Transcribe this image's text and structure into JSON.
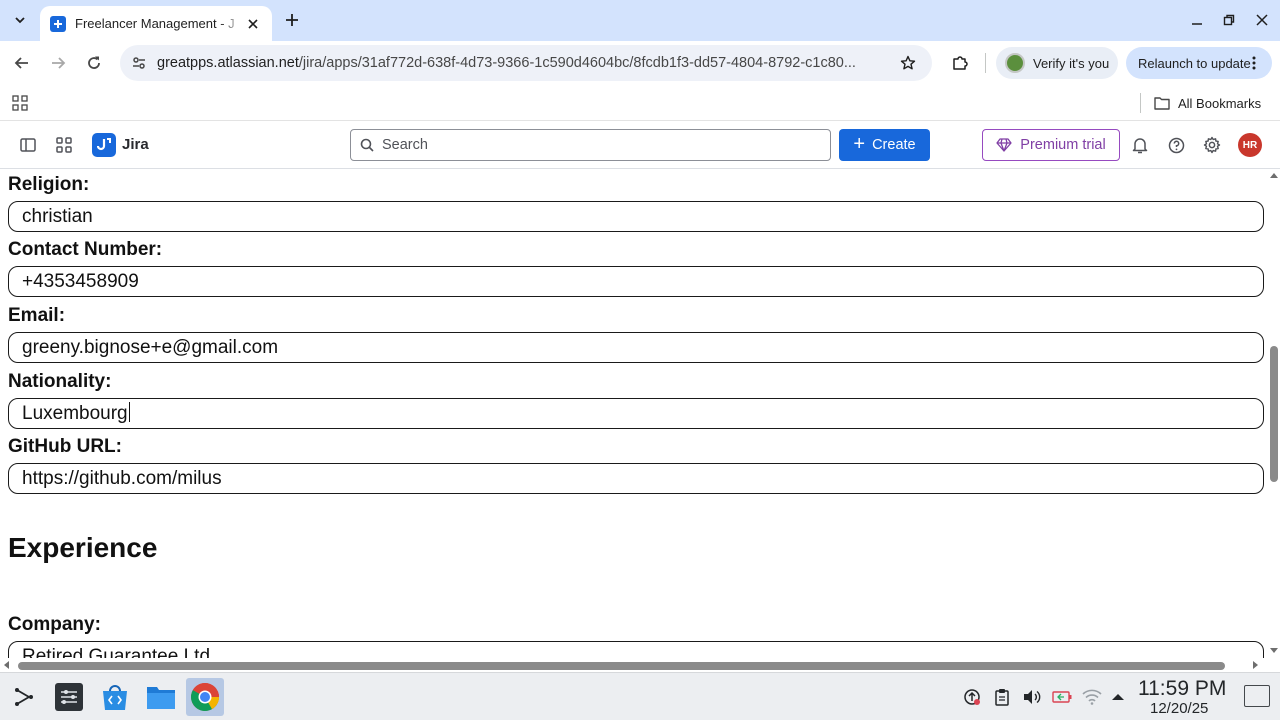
{
  "browser": {
    "tab_title": "Freelancer Management - J",
    "url_host": "greatpps.atlassian.net",
    "url_path": "/jira/apps/31af772d-638f-4d73-9366-1c590d4604bc/8fcdb1f3-dd57-4804-8792-c1c80...",
    "verify_label": "Verify it's you",
    "relaunch_label": "Relaunch to update",
    "all_bookmarks_label": "All Bookmarks"
  },
  "jira": {
    "product_name": "Jira",
    "search_placeholder": "Search",
    "create_label": "Create",
    "premium_label": "Premium trial",
    "avatar_initials": "HR",
    "brand_color": "#1868db"
  },
  "form": {
    "fields": [
      {
        "label": "Religion:",
        "value": "christian"
      },
      {
        "label": "Contact Number:",
        "value": "+4353458909"
      },
      {
        "label": "Email:",
        "value": "greeny.bignose+e@gmail.com"
      },
      {
        "label": "Nationality:",
        "value": "Luxembourg"
      },
      {
        "label": "GitHub URL:",
        "value": "https://github.com/milus"
      }
    ],
    "experience_heading": "Experience",
    "company_label": "Company:",
    "company_value": "Retired Guarantee Ltd"
  },
  "taskbar": {
    "time": "11:59 PM",
    "date": "12/20/25"
  }
}
